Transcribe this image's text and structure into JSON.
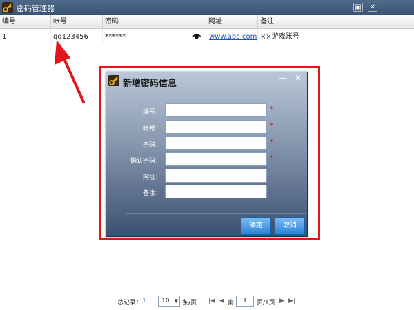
{
  "window": {
    "title": "密码管理器",
    "restore_glyph": "▣",
    "close_glyph": "✕"
  },
  "table": {
    "columns": [
      "编号",
      "帐号",
      "密码",
      "网址",
      "备注"
    ],
    "rows": [
      {
        "id": "1",
        "account": "qq123456",
        "password": "******",
        "url": "www.abc.com",
        "note": "××游戏账号"
      }
    ]
  },
  "dialog": {
    "title": "新增密码信息",
    "minimize_glyph": "—",
    "close_glyph": "✕",
    "fields": [
      {
        "label": "编号：",
        "value": "",
        "required": true
      },
      {
        "label": "帐号：",
        "value": "",
        "required": true
      },
      {
        "label": "密码：",
        "value": "",
        "required": true
      },
      {
        "label": "确认密码：",
        "value": "",
        "required": true
      },
      {
        "label": "网址：",
        "value": "",
        "required": false
      },
      {
        "label": "备注：",
        "value": "",
        "required": false
      }
    ],
    "required_mark": "*",
    "confirm_label": "确定",
    "cancel_label": "取消"
  },
  "footer": {
    "total_label": "总记录：",
    "total_count": "1",
    "page_size": "10",
    "per_page_label": "条/页",
    "page_prefix": "第",
    "current_page": "1",
    "page_suffix": "页/1页",
    "first_glyph": "|◀",
    "prev_glyph": "◀",
    "next_glyph": "▶",
    "last_glyph": "▶|"
  },
  "colors": {
    "annotation": "#e0161b",
    "link": "#1a55c4",
    "button": "#2c83d8",
    "titlebar": "#3a5372"
  }
}
